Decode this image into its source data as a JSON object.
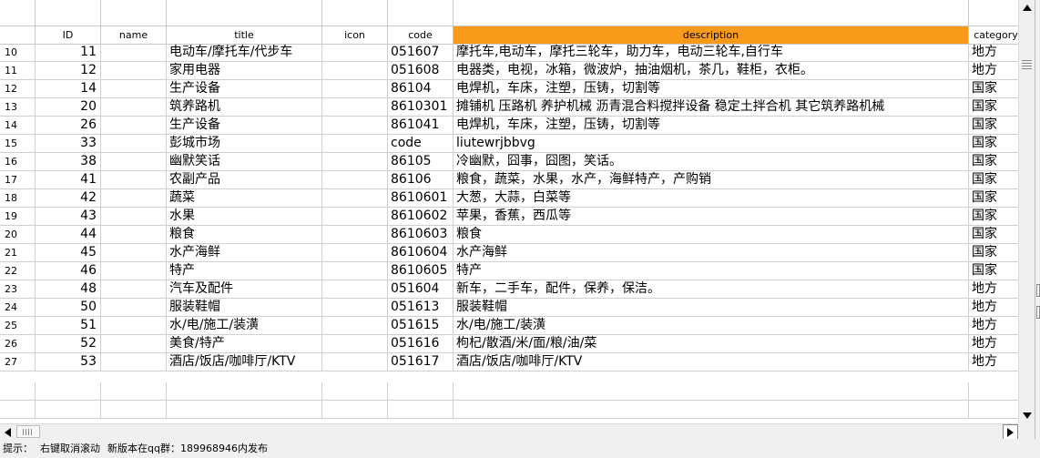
{
  "grid": {
    "columns": [
      {
        "key": "rownum",
        "label": "",
        "width": 39
      },
      {
        "key": "id",
        "label": "ID",
        "width": 72
      },
      {
        "key": "name",
        "label": "name",
        "width": 72
      },
      {
        "key": "title",
        "label": "title",
        "width": 171
      },
      {
        "key": "icon",
        "label": "icon",
        "width": 72
      },
      {
        "key": "code",
        "label": "code",
        "width": 72
      },
      {
        "key": "description",
        "label": "description",
        "width": 566,
        "active": true
      },
      {
        "key": "category",
        "label": "category",
        "width": 60
      }
    ],
    "rows": [
      {
        "rownum": "10",
        "id": "11",
        "name": "",
        "title": "电动车/摩托车/代步车",
        "icon": "",
        "code": "051607",
        "description": "摩托车,电动车，摩托三轮车，助力车，电动三轮车,自行车",
        "category": "地方"
      },
      {
        "rownum": "11",
        "id": "12",
        "name": "",
        "title": "家用电器",
        "icon": "",
        "code": "051608",
        "description": "电器类，电视，冰箱，微波炉，抽油烟机，茶几，鞋柜，衣柜。",
        "category": "地方"
      },
      {
        "rownum": "12",
        "id": "14",
        "name": "",
        "title": "生产设备",
        "icon": "",
        "code": "86104",
        "description": "电焊机，车床，注塑，压铸，切割等",
        "category": "国家"
      },
      {
        "rownum": "13",
        "id": "20",
        "name": "",
        "title": "筑养路机",
        "icon": "",
        "code": "8610301",
        "description": "摊铺机 压路机 养护机械 沥青混合料搅拌设备 稳定土拌合机 其它筑养路机械",
        "category": "国家"
      },
      {
        "rownum": "14",
        "id": "26",
        "name": "",
        "title": "生产设备",
        "icon": "",
        "code": "861041",
        "description": "电焊机，车床，注塑，压铸，切割等",
        "category": "国家"
      },
      {
        "rownum": "15",
        "id": "33",
        "name": "",
        "title": "彭城市场",
        "icon": "",
        "code": "code",
        "description": "liutewrjbbvg",
        "category": "国家"
      },
      {
        "rownum": "16",
        "id": "38",
        "name": "",
        "title": "幽默笑话",
        "icon": "",
        "code": "86105",
        "description": "冷幽默，囧事，囧图，笑话。",
        "category": "国家"
      },
      {
        "rownum": "17",
        "id": "41",
        "name": "",
        "title": "农副产品",
        "icon": "",
        "code": "86106",
        "description": "粮食，蔬菜，水果，水产，海鲜特产，产购销",
        "category": "国家"
      },
      {
        "rownum": "18",
        "id": "42",
        "name": "",
        "title": "蔬菜",
        "icon": "",
        "code": "8610601",
        "description": "大葱，大蒜，白菜等",
        "category": "国家"
      },
      {
        "rownum": "19",
        "id": "43",
        "name": "",
        "title": "水果",
        "icon": "",
        "code": "8610602",
        "description": "苹果，香蕉，西瓜等",
        "category": "国家"
      },
      {
        "rownum": "20",
        "id": "44",
        "name": "",
        "title": "粮食",
        "icon": "",
        "code": "8610603",
        "description": "粮食",
        "category": "国家"
      },
      {
        "rownum": "21",
        "id": "45",
        "name": "",
        "title": "水产海鲜",
        "icon": "",
        "code": "8610604",
        "description": "水产海鲜",
        "category": "国家"
      },
      {
        "rownum": "22",
        "id": "46",
        "name": "",
        "title": "特产",
        "icon": "",
        "code": "8610605",
        "description": "特产",
        "category": "国家"
      },
      {
        "rownum": "23",
        "id": "48",
        "name": "",
        "title": "汽车及配件",
        "icon": "",
        "code": "051604",
        "description": "新车，二手车，配件，保养，保洁。",
        "category": "地方"
      },
      {
        "rownum": "24",
        "id": "50",
        "name": "",
        "title": "服装鞋帽",
        "icon": "",
        "code": "051613",
        "description": "服装鞋帽",
        "category": "地方"
      },
      {
        "rownum": "25",
        "id": "51",
        "name": "",
        "title": "水/电/施工/装潢",
        "icon": "",
        "code": "051615",
        "description": "水/电/施工/装潢",
        "category": "地方"
      },
      {
        "rownum": "26",
        "id": "52",
        "name": "",
        "title": "美食/特产",
        "icon": "",
        "code": "051616",
        "description": "枸杞/散酒/米/面/粮/油/菜",
        "category": "地方"
      },
      {
        "rownum": "27",
        "id": "53",
        "name": "",
        "title": "酒店/饭店/咖啡厅/KTV",
        "icon": "",
        "code": "051617",
        "description": "酒店/饭店/咖啡厅/KTV",
        "category": "地方"
      }
    ],
    "empty_rows": 2
  },
  "status": {
    "hint_label": "提示：",
    "hint_1": "右键取消滚动",
    "hint_2": "新版本在qq群：189968946内发布"
  },
  "colors": {
    "active_header": "#f99a1a",
    "grid_line": "#d0d0d0"
  }
}
